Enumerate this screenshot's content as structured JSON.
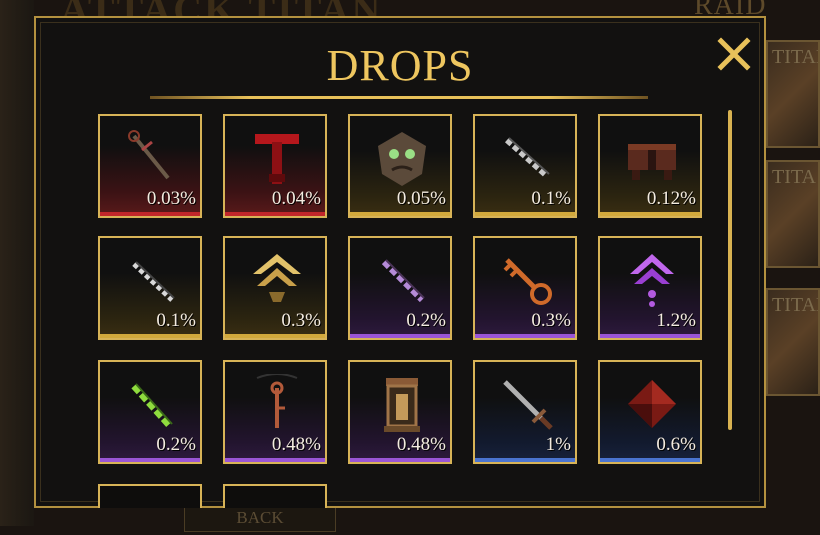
{
  "background": {
    "title": "ATTACK TITAN",
    "raid_label": "RAID",
    "side_cards": [
      "TITAN",
      "TITA",
      "TITAN"
    ],
    "back_label": "BACK"
  },
  "modal": {
    "title": "DROPS",
    "close_icon": "close-x-icon",
    "colors": {
      "gold": "#e8c15a",
      "red": "#c1262a",
      "purple": "#9a55d6",
      "blue": "#4a74d0"
    }
  },
  "drops": [
    {
      "item": "syringe-blade-icon",
      "chance": "0.03%",
      "rarity": "red"
    },
    {
      "item": "crimson-hammer-icon",
      "chance": "0.04%",
      "rarity": "red"
    },
    {
      "item": "titan-head-icon",
      "chance": "0.05%",
      "rarity": "gold"
    },
    {
      "item": "chain-blade-icon",
      "chance": "0.1%",
      "rarity": "gold"
    },
    {
      "item": "rusty-chest-icon",
      "chance": "0.12%",
      "rarity": "gold"
    },
    {
      "item": "bone-blade-icon",
      "chance": "0.1%",
      "rarity": "gold"
    },
    {
      "item": "gold-rank-chevron-icon",
      "chance": "0.3%",
      "rarity": "gold"
    },
    {
      "item": "purple-blade-icon",
      "chance": "0.2%",
      "rarity": "purple"
    },
    {
      "item": "bronze-key-icon",
      "chance": "0.3%",
      "rarity": "purple"
    },
    {
      "item": "purple-rank-chevron-icon",
      "chance": "1.2%",
      "rarity": "purple"
    },
    {
      "item": "green-blade-icon",
      "chance": "0.2%",
      "rarity": "purple"
    },
    {
      "item": "rusty-key-pendant-icon",
      "chance": "0.48%",
      "rarity": "purple"
    },
    {
      "item": "lantern-shrine-icon",
      "chance": "0.48%",
      "rarity": "purple"
    },
    {
      "item": "long-sword-icon",
      "chance": "1%",
      "rarity": "blue"
    },
    {
      "item": "red-crystal-icon",
      "chance": "0.6%",
      "rarity": "blue"
    }
  ]
}
